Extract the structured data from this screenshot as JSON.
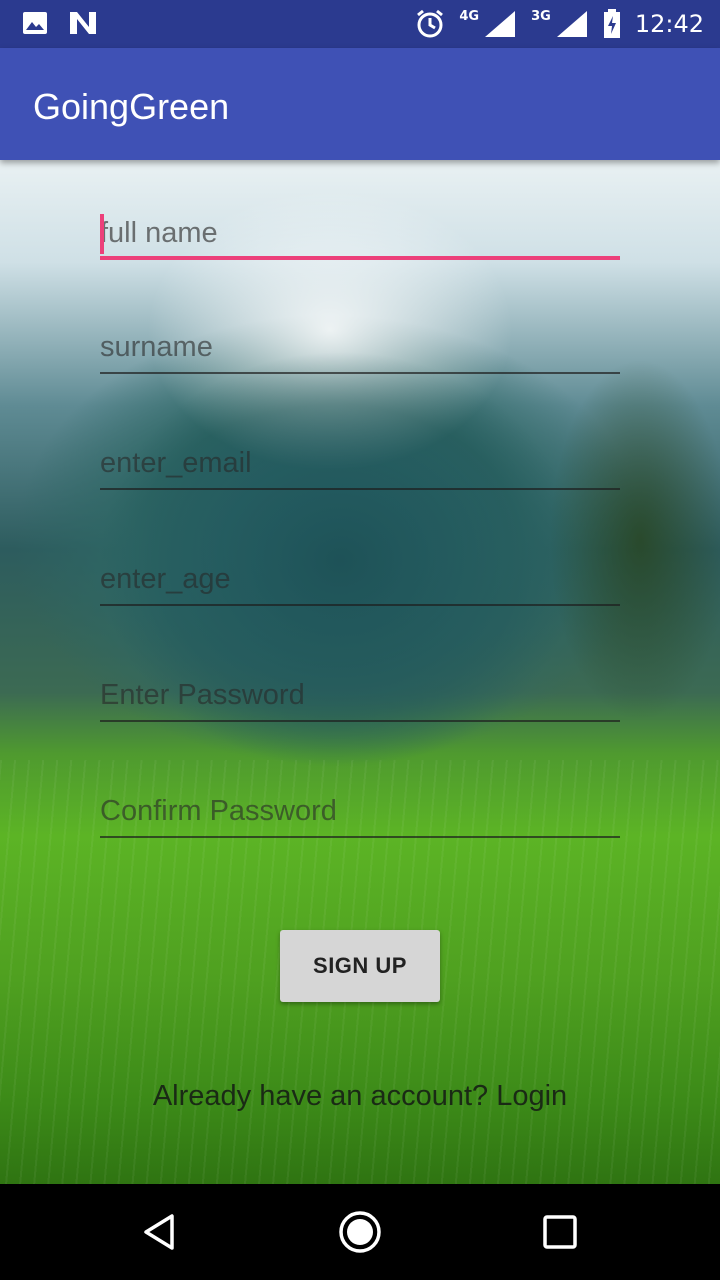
{
  "status_bar": {
    "time": "12:42",
    "network_4g": "4G",
    "network_3g": "3G",
    "icons": [
      "image-icon",
      "n-notification-icon",
      "alarm-icon",
      "signal-4g-icon",
      "signal-3g-icon",
      "battery-charging-icon"
    ]
  },
  "app_bar": {
    "title": "GoingGreen"
  },
  "form": {
    "full_name_placeholder": "full name",
    "surname_placeholder": "surname",
    "email_placeholder": "enter_email",
    "age_placeholder": "enter_age",
    "password_placeholder": "Enter Password",
    "confirm_password_placeholder": "Confirm Password",
    "signup_label": "SIGN UP",
    "login_prompt": "Already have an account? Login"
  },
  "colors": {
    "status_bar": "#2b3a8f",
    "app_bar": "#3f51b5",
    "accent": "#ec407a",
    "button": "#d6d6d6"
  },
  "nav_bar": {
    "icons": [
      "back-icon",
      "home-icon",
      "recents-icon"
    ]
  }
}
